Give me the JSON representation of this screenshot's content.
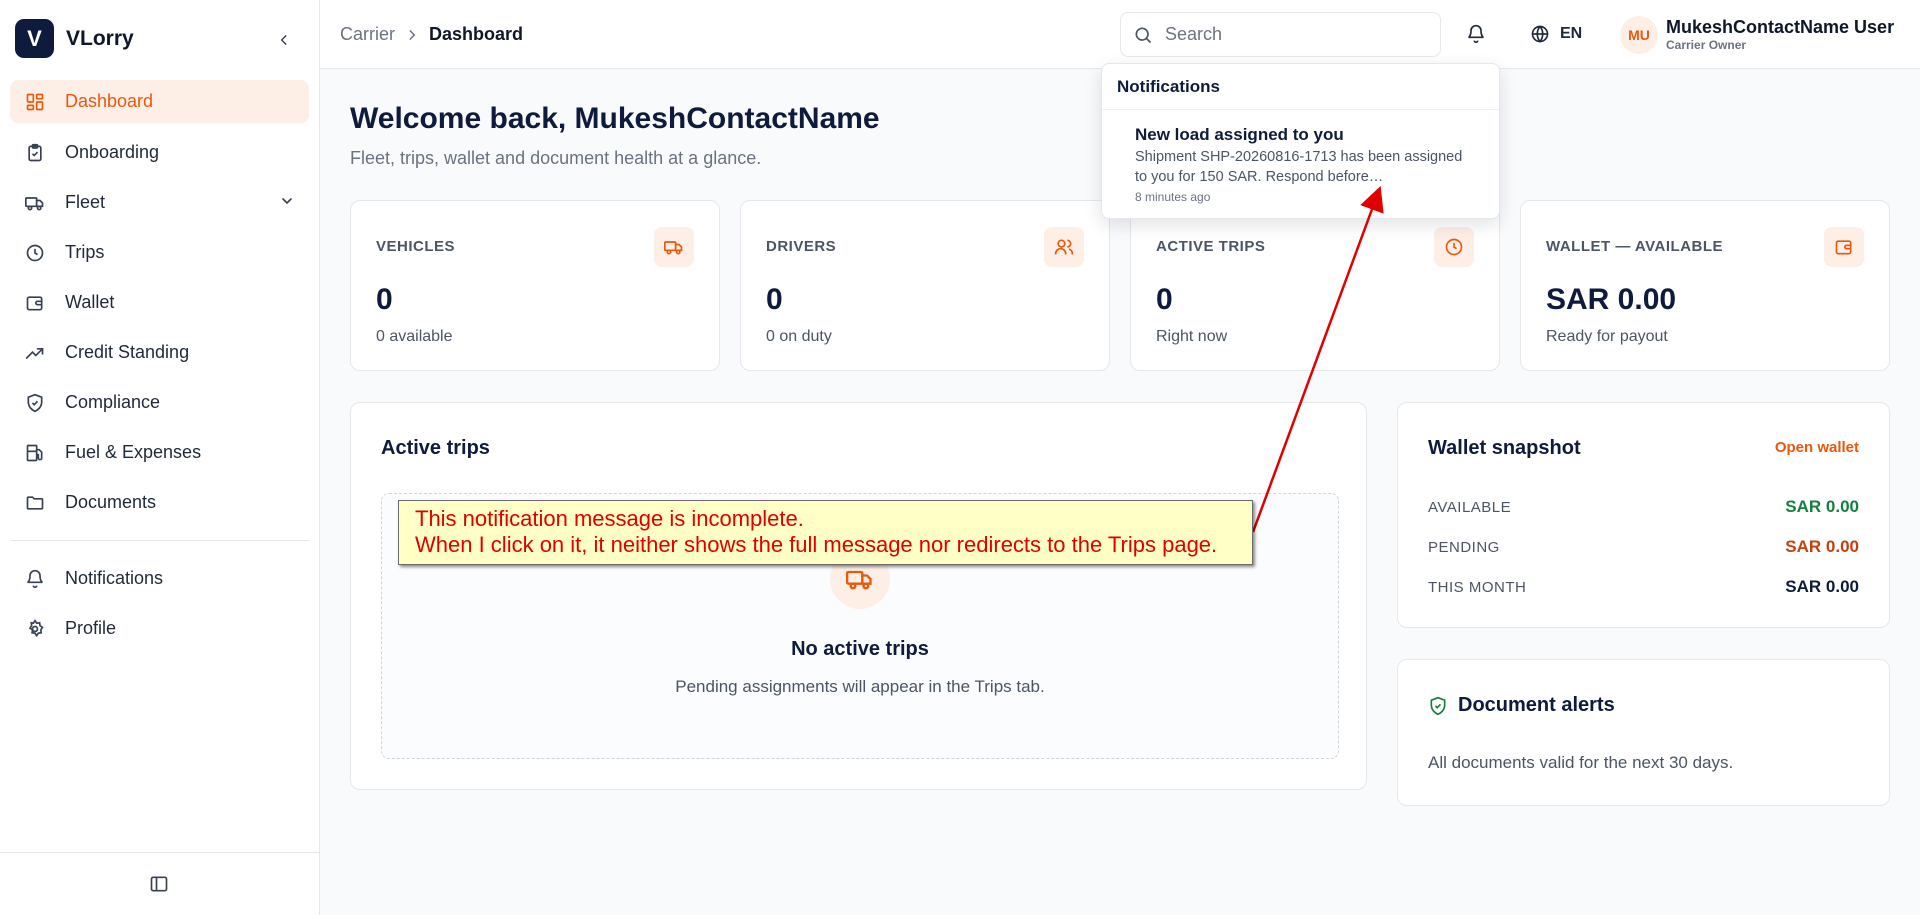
{
  "brand": {
    "logo_letter": "V",
    "name": "VLorry"
  },
  "sidebar": {
    "items": [
      {
        "label": "Dashboard",
        "icon": "dashboard-icon",
        "active": true
      },
      {
        "label": "Onboarding",
        "icon": "clipboard-icon"
      },
      {
        "label": "Fleet",
        "icon": "truck-icon",
        "has_children": true
      },
      {
        "label": "Trips",
        "icon": "clock-icon"
      },
      {
        "label": "Wallet",
        "icon": "wallet-icon"
      },
      {
        "label": "Credit Standing",
        "icon": "trending-up-icon"
      },
      {
        "label": "Compliance",
        "icon": "shield-check-icon"
      },
      {
        "label": "Fuel & Expenses",
        "icon": "fuel-icon"
      },
      {
        "label": "Documents",
        "icon": "folder-icon"
      },
      {
        "label": "Notifications",
        "icon": "bell-icon"
      },
      {
        "label": "Profile",
        "icon": "gear-icon"
      }
    ]
  },
  "header": {
    "breadcrumb": [
      "Carrier",
      "Dashboard"
    ],
    "search_placeholder": "Search",
    "language": "EN",
    "user": {
      "initials": "MU",
      "name": "MukeshContactName User",
      "role": "Carrier Owner"
    }
  },
  "notifications": {
    "title": "Notifications",
    "items": [
      {
        "title": "New load assigned to you",
        "body_line1": "Shipment SHP-20260816-1713 has been assigned",
        "body_line2": "to you for 150 SAR. Respond before…",
        "time": "8 minutes ago"
      }
    ]
  },
  "main": {
    "welcome": "Welcome back, MukeshContactName",
    "subtitle": "Fleet, trips, wallet and document health at a glance.",
    "stats": [
      {
        "label": "VEHICLES",
        "value": "0",
        "sub": "0 available",
        "icon": "truck-icon"
      },
      {
        "label": "DRIVERS",
        "value": "0",
        "sub": "0 on duty",
        "icon": "users-icon"
      },
      {
        "label": "ACTIVE TRIPS",
        "value": "0",
        "sub": "Right now",
        "icon": "clock-icon"
      },
      {
        "label": "WALLET — AVAILABLE",
        "value": "SAR 0.00",
        "sub": "Ready for payout",
        "icon": "wallet-icon"
      }
    ],
    "active_trips": {
      "title": "Active trips",
      "empty_title": "No active trips",
      "empty_sub": "Pending assignments will appear in the Trips tab."
    },
    "wallet_snapshot": {
      "title": "Wallet snapshot",
      "link": "Open wallet",
      "rows": [
        {
          "label": "AVAILABLE",
          "value": "SAR 0.00",
          "color": "#15803d"
        },
        {
          "label": "PENDING",
          "value": "SAR 0.00",
          "color": "#c2410c"
        },
        {
          "label": "THIS MONTH",
          "value": "SAR 0.00",
          "color": "#0f1b3d"
        }
      ]
    },
    "document_alerts": {
      "title": "Document alerts",
      "text": "All documents valid for the next 30 days."
    }
  },
  "annotation": {
    "line1": "This notification message is incomplete.",
    "line2": "When I click on it, it neither shows the full message nor redirects to the Trips page.",
    "color": "#e10000"
  },
  "colors": {
    "accent": "#ea580c",
    "accent_bg": "#fdeee6",
    "navy": "#0f1b3d"
  }
}
